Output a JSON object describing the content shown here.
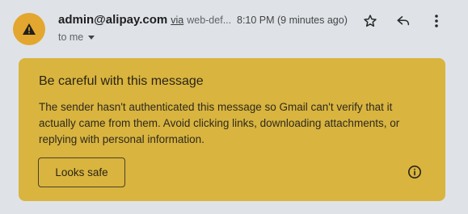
{
  "header": {
    "avatar_icon": "warning-icon",
    "avatar_color": "#e3a72f",
    "sender_email": "admin@alipay.com",
    "via_label": "via",
    "via_domain": "web-def...",
    "time": "8:10 PM (9 minutes ago)",
    "recipient": "to me",
    "actions": [
      "star-icon",
      "reply-icon",
      "more-vert-icon"
    ]
  },
  "warning": {
    "title": "Be careful with this message",
    "body": "The sender hasn't authenticated this message so Gmail can't verify that it actually came from them. Avoid clicking links, downloading attachments, or replying with personal information.",
    "button_label": "Looks safe",
    "info_icon": "info-icon",
    "background_color": "#d9b43f"
  }
}
